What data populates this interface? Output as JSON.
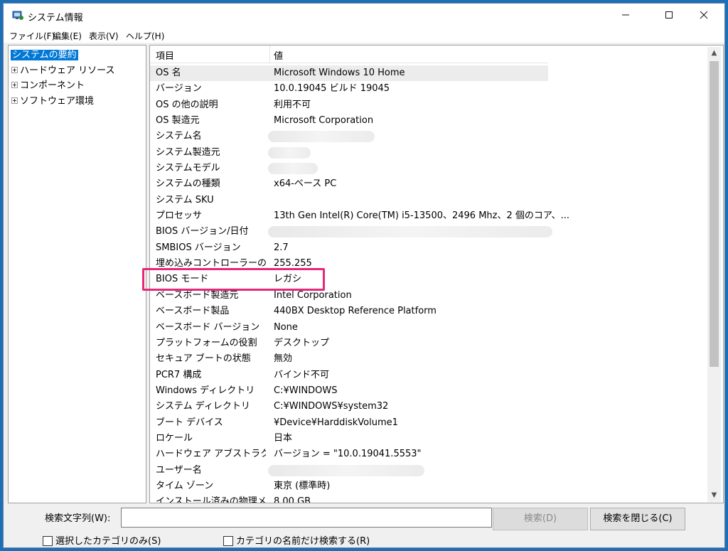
{
  "window": {
    "title": "システム情報"
  },
  "menu": [
    "ファイル(F)",
    "編集(E)",
    "表示(V)",
    "ヘルプ(H)"
  ],
  "tree": {
    "selected": "システムの要約",
    "items": [
      "ハードウェア リソース",
      "コンポーネント",
      "ソフトウェア環境"
    ]
  },
  "table": {
    "headers": [
      "項目",
      "値"
    ],
    "rows": [
      [
        "OS 名",
        "Microsoft Windows 10 Home"
      ],
      [
        "バージョン",
        "10.0.19045 ビルド 19045"
      ],
      [
        "OS の他の説明",
        "利用不可"
      ],
      [
        "OS 製造元",
        "Microsoft Corporation"
      ],
      [
        "システム名",
        ""
      ],
      [
        "システム製造元",
        ""
      ],
      [
        "システムモデル",
        ""
      ],
      [
        "システムの種類",
        "x64-ベース PC"
      ],
      [
        "システム SKU",
        ""
      ],
      [
        "プロセッサ",
        "13th Gen Intel(R) Core(TM) i5-13500、2496 Mhz、2 個のコア、..."
      ],
      [
        "BIOS バージョン/日付",
        ""
      ],
      [
        "SMBIOS バージョン",
        "2.7"
      ],
      [
        "埋め込みコントローラーのバ...",
        "255.255"
      ],
      [
        "BIOS モード",
        "レガシ"
      ],
      [
        "ベースボード製造元",
        "Intel Corporation"
      ],
      [
        "ベースボード製品",
        "440BX Desktop Reference Platform"
      ],
      [
        "ベースボード バージョン",
        "None"
      ],
      [
        "プラットフォームの役割",
        "デスクトップ"
      ],
      [
        "セキュア ブートの状態",
        "無効"
      ],
      [
        "PCR7 構成",
        "バインド不可"
      ],
      [
        "Windows ディレクトリ",
        "C:¥WINDOWS"
      ],
      [
        "システム ディレクトリ",
        "C:¥WINDOWS¥system32"
      ],
      [
        "ブート デバイス",
        "¥Device¥HarddiskVolume1"
      ],
      [
        "ロケール",
        "日本"
      ],
      [
        "ハードウェア アブストラクショ...",
        "バージョン = \"10.0.19041.5553\""
      ],
      [
        "ユーザー名",
        ""
      ],
      [
        "タイム ゾーン",
        "東京 (標準時)"
      ],
      [
        "インストール済みの物理メモ...",
        "8.00 GB"
      ]
    ]
  },
  "search": {
    "label": "検索文字列(W):",
    "value": "",
    "find_button": "検索(D)",
    "close_button": "検索を閉じる(C)",
    "check_selected_only": "選択したカテゴリのみ(S)",
    "check_names_only": "カテゴリの名前だけ検索する(R)"
  },
  "accent": {
    "selection": "#0078d7",
    "highlight_box": "#e8267a"
  }
}
